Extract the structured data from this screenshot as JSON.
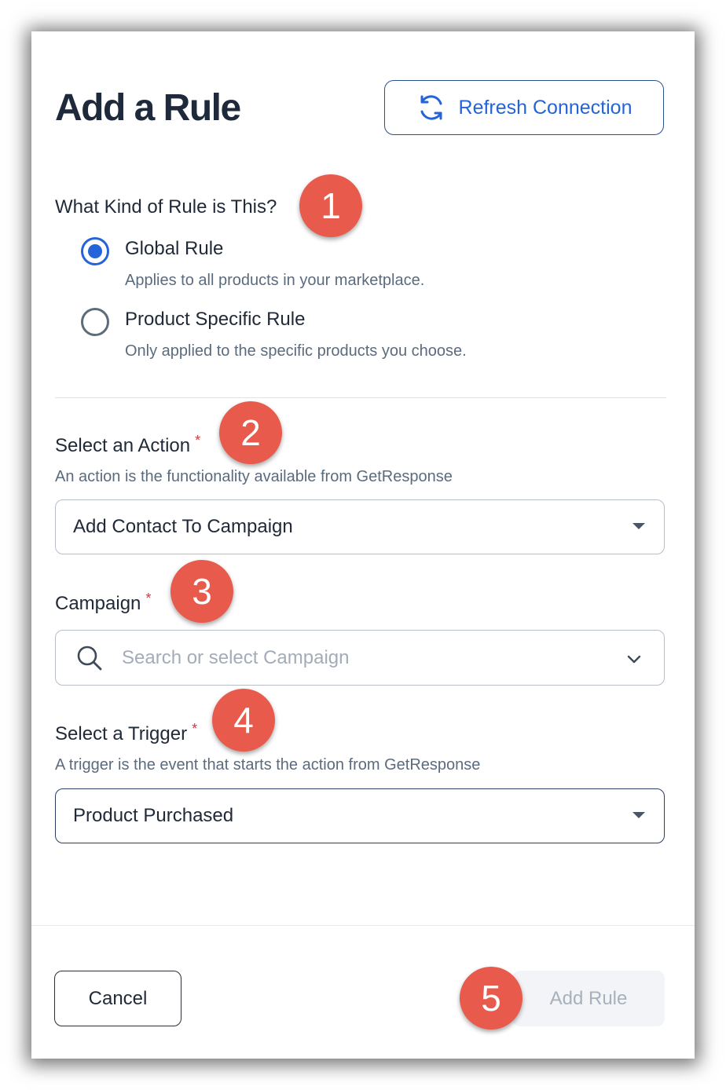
{
  "title": "Add a Rule",
  "refresh_button": {
    "label": "Refresh Connection",
    "icon": "refresh-icon"
  },
  "rule_type": {
    "question": "What Kind of Rule is This?",
    "options": [
      {
        "label": "Global Rule",
        "description": "Applies to all products in your marketplace.",
        "checked": true
      },
      {
        "label": "Product Specific Rule",
        "description": "Only applied to the specific products you choose.",
        "checked": false
      }
    ]
  },
  "action": {
    "label": "Select an Action",
    "required_mark": "*",
    "hint": "An action is the functionality available from GetResponse",
    "value": "Add Contact To Campaign"
  },
  "campaign": {
    "label": "Campaign",
    "required_mark": "*",
    "placeholder": "Search or select Campaign"
  },
  "trigger": {
    "label": "Select a Trigger",
    "required_mark": "*",
    "hint": "A trigger is the event that starts the action from GetResponse",
    "value": "Product Purchased"
  },
  "footer": {
    "cancel_label": "Cancel",
    "add_label": "Add Rule"
  },
  "step_markers": [
    "1",
    "2",
    "3",
    "4",
    "5"
  ],
  "colors": {
    "accent": "#2563d8",
    "marker": "#e85b4c",
    "required": "#d9363e",
    "title": "#1e2a3b"
  }
}
